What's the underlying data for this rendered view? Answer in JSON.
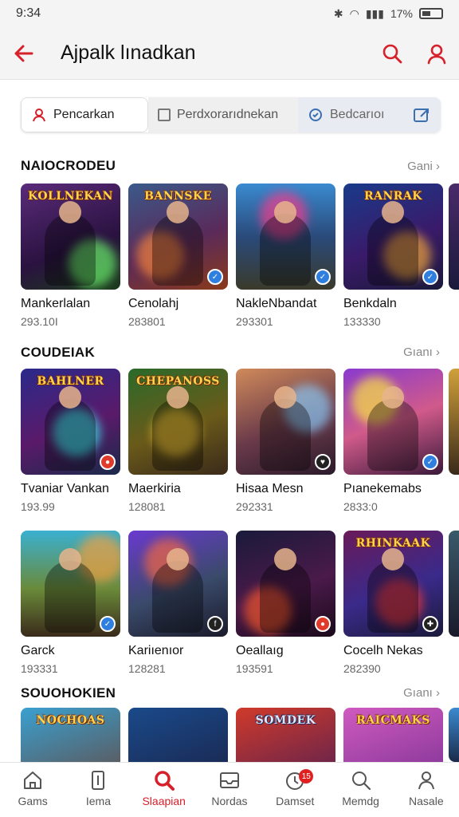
{
  "status": {
    "time": "9:34",
    "battery": "17%"
  },
  "header": {
    "title": "Ajpalk lınadkan"
  },
  "tabs": [
    {
      "label": "Pencarkan"
    },
    {
      "label": "Perdxorarıdnekan"
    },
    {
      "label": "Bedcarıoı"
    }
  ],
  "sections": [
    {
      "title": "NAIOCRODEU",
      "more": "Gani",
      "games": [
        {
          "logo": "KOLLNEKAN",
          "name": "Mankerlalan",
          "count": "293.10Ι"
        },
        {
          "logo": "BANNSKE",
          "name": "Cenolahj",
          "count": "283801"
        },
        {
          "logo": "",
          "name": "NakleNbandat",
          "count": "293301"
        },
        {
          "logo": "RANRAK",
          "name": "Benkdaln",
          "count": "133330"
        }
      ]
    },
    {
      "title": "COUDEIAK",
      "more": "Gıanı",
      "games": [
        {
          "logo": "BAHLNER",
          "name": "Tvaniar Vankan",
          "count": "193.99"
        },
        {
          "logo": "CHEPANOSS",
          "name": "Maerkiria",
          "count": "128081"
        },
        {
          "logo": "",
          "name": "Hisaa Mesn",
          "count": "292331"
        },
        {
          "logo": "",
          "name": "Pıanekemabs",
          "count": "2833:0"
        }
      ]
    },
    {
      "title": "",
      "more": "",
      "games": [
        {
          "logo": "",
          "name": "Garck",
          "count": "193331"
        },
        {
          "logo": "",
          "name": "Kariıenıor",
          "count": "128281"
        },
        {
          "logo": "",
          "name": "Oeallaıg",
          "count": "193591"
        },
        {
          "logo": "RHINKAAK",
          "name": "Cocelh Nekas",
          "count": "282390"
        }
      ]
    },
    {
      "title": "SOUOHOKIEN",
      "more": "Gıanı",
      "games": [
        {
          "logo": "NOCHOAS",
          "name": "",
          "count": ""
        },
        {
          "logo": "",
          "name": "",
          "count": ""
        },
        {
          "logo": "SOMDEK",
          "name": "",
          "count": ""
        },
        {
          "logo": "RAICMAKS",
          "name": "",
          "count": ""
        }
      ]
    }
  ],
  "nav": [
    {
      "label": "Gams",
      "icon": "home-icon"
    },
    {
      "label": "Iema",
      "icon": "door-icon"
    },
    {
      "label": "Slaapian",
      "icon": "search-icon",
      "active": true
    },
    {
      "label": "Nordas",
      "icon": "inbox-icon"
    },
    {
      "label": "Damset",
      "icon": "history-icon",
      "badge": "15"
    },
    {
      "label": "Memdg",
      "icon": "search-icon"
    },
    {
      "label": "Nasale",
      "icon": "profile-icon"
    }
  ],
  "colors": {
    "accent": "#d6202a"
  }
}
